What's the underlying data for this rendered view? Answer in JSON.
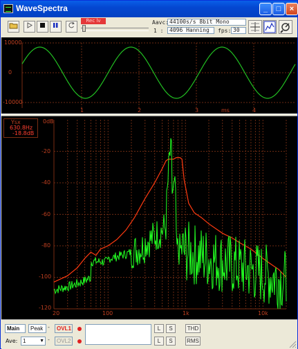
{
  "window": {
    "title": "WaveSpectra"
  },
  "titlebar_buttons": {
    "minimize": "_",
    "maximize": "□",
    "close": "×"
  },
  "toolbar": {
    "rec_label": "Rec lv",
    "aavc_label": "Aavc:",
    "format_value": "44100s/s  8bit Mono",
    "row2_label": "1  :",
    "window_value": "4096 Hanning",
    "fps_label": "fps:",
    "fps_value": "30",
    "buttons": [
      "open-file",
      "play",
      "stop",
      "pause",
      "loop"
    ]
  },
  "wave_panel": {
    "y_labels": [
      "10000",
      "0",
      "-10000"
    ],
    "x_labels": [
      "1",
      "2",
      "3",
      "4"
    ],
    "x_unit": "ms"
  },
  "spectrum_panel": {
    "unit": "0dB",
    "cursor_label": "Ysx",
    "cursor_freq": "630.8Hz",
    "cursor_level": "-18.8dB",
    "y_labels": [
      "-20",
      "-40",
      "-60",
      "-80",
      "-100",
      "-120"
    ],
    "x_labels": [
      "20",
      "100",
      "1k",
      "10k"
    ]
  },
  "bottom_panel": {
    "main_label": "Main",
    "mode_value": "Peak",
    "ovl1_label": "OVL1",
    "ovl2_label": "OVL2",
    "ave_label": "Ave:",
    "ave_value": "1",
    "l_label": "L",
    "s_label": "S",
    "thd_label": "THD",
    "rms_label": "RMS"
  },
  "colors": {
    "wave": "#22C022",
    "spectrum_fill": "#22FF22",
    "peak_hold": "#FF3A10",
    "grid": "#6B2A12",
    "axis_label": "#C04020"
  }
}
